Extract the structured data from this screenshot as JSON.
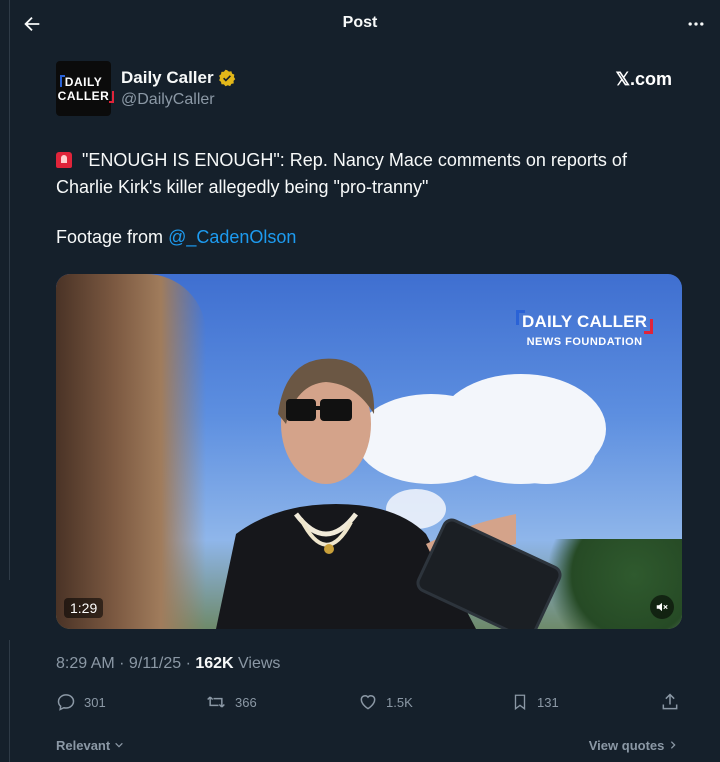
{
  "header": {
    "title": "Post"
  },
  "author": {
    "avatar_line1": "DAILY",
    "avatar_line2": "CALLER",
    "name": "Daily Caller",
    "handle": "@DailyCaller"
  },
  "source_link": "𝕏.com",
  "post": {
    "text": "\"ENOUGH IS ENOUGH\": Rep. Nancy Mace comments on reports of Charlie Kirk's killer allegedly being \"pro-tranny\"",
    "footage_label": "Footage from ",
    "mention": "@_CadenOlson"
  },
  "media": {
    "logo_line1": "DAILY CALLER",
    "logo_line2": "NEWS FOUNDATION",
    "duration": "1:29"
  },
  "meta": {
    "time": "8:29 AM · 9/11/25 · ",
    "views_count": "162K",
    "views_label": " Views"
  },
  "actions": {
    "replies": "301",
    "reposts": "366",
    "likes": "1.5K",
    "bookmarks": "131"
  },
  "footer": {
    "relevant": "Relevant",
    "view_quotes": "View quotes"
  },
  "colors": {
    "accent": "#1d9bf0",
    "background": "#15202b",
    "muted": "#8b98a5",
    "verified": "#e2b719"
  }
}
